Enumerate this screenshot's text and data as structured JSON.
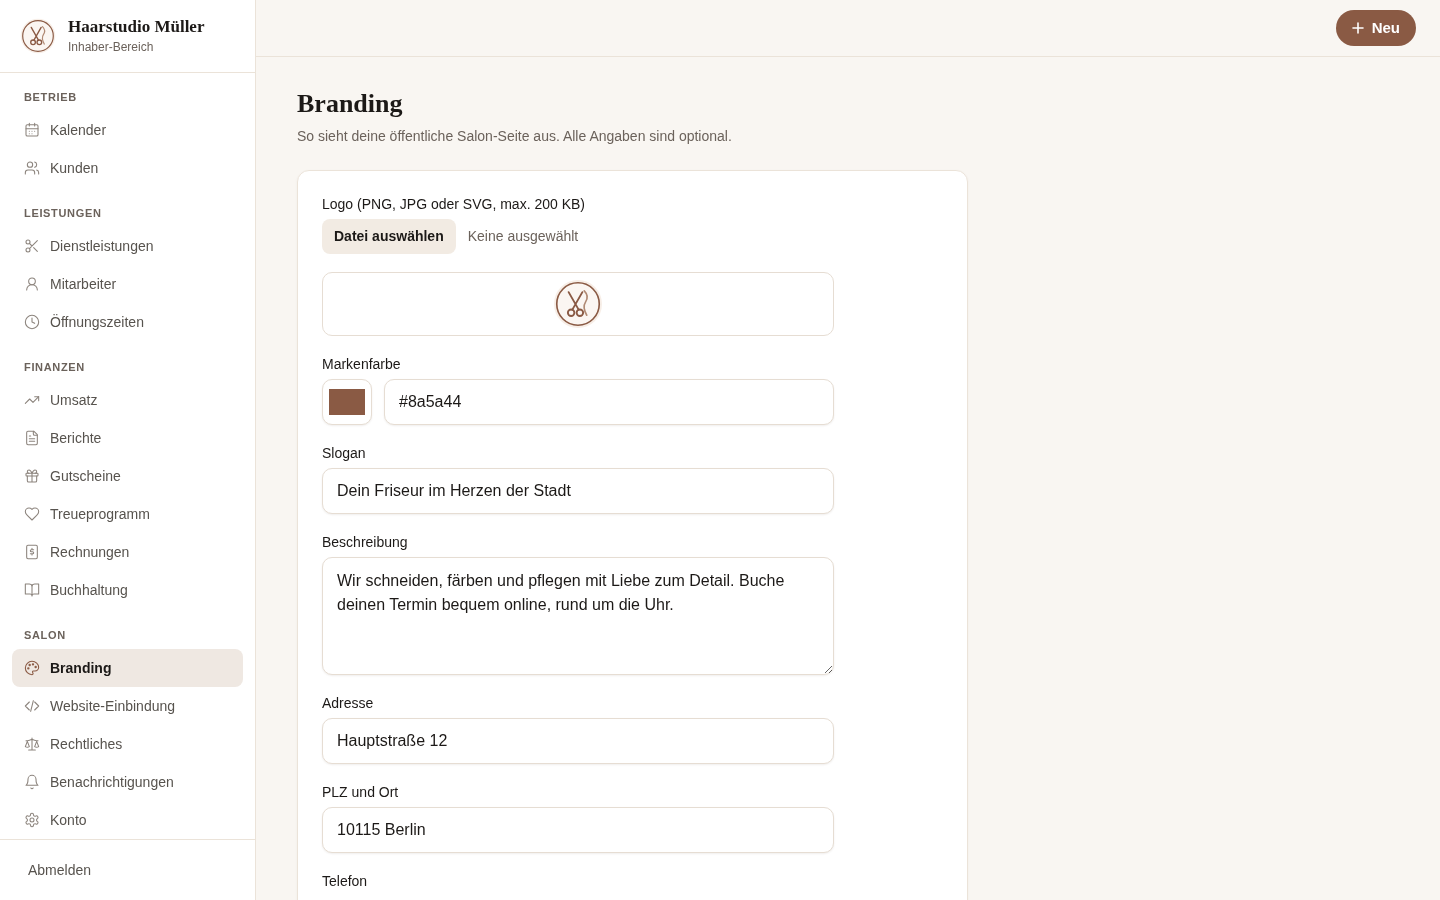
{
  "sidebar": {
    "brand": {
      "name": "Haarstudio Müller",
      "subtitle": "Inhaber-Bereich"
    },
    "sections": [
      {
        "title": "BETRIEB",
        "items": [
          {
            "label": "Kalender",
            "selected": false
          },
          {
            "label": "Kunden",
            "selected": false
          }
        ]
      },
      {
        "title": "LEISTUNGEN",
        "items": [
          {
            "label": "Dienstleistungen",
            "selected": false
          },
          {
            "label": "Mitarbeiter",
            "selected": false
          },
          {
            "label": "Öffnungszeiten",
            "selected": false
          }
        ]
      },
      {
        "title": "FINANZEN",
        "items": [
          {
            "label": "Umsatz",
            "selected": false
          },
          {
            "label": "Berichte",
            "selected": false
          },
          {
            "label": "Gutscheine",
            "selected": false
          },
          {
            "label": "Treueprogramm",
            "selected": false
          },
          {
            "label": "Rechnungen",
            "selected": false
          },
          {
            "label": "Buchhaltung",
            "selected": false
          }
        ]
      },
      {
        "title": "SALON",
        "items": [
          {
            "label": "Branding",
            "selected": true
          },
          {
            "label": "Website-Einbindung",
            "selected": false
          },
          {
            "label": "Rechtliches",
            "selected": false
          },
          {
            "label": "Benachrichtigungen",
            "selected": false
          },
          {
            "label": "Konto",
            "selected": false
          }
        ]
      }
    ],
    "footer": {
      "logout": "Abmelden"
    }
  },
  "topbar": {
    "new_button": "Neu"
  },
  "page": {
    "title": "Branding",
    "subtitle": "So sieht deine öffentliche Salon-Seite aus. Alle Angaben sind optional."
  },
  "form": {
    "fields": [
      {
        "kind": "file",
        "label": "Logo (PNG, JPG oder SVG, max. 200 KB)",
        "button": "Datei auswählen",
        "status": "Keine ausgewählt"
      },
      {
        "kind": "color",
        "label": "Markenfarbe",
        "value": "#8a5a44"
      },
      {
        "kind": "text",
        "label": "Slogan",
        "value": "Dein Friseur im Herzen der Stadt"
      },
      {
        "kind": "textarea",
        "label": "Beschreibung",
        "value": "Wir schneiden, färben und pflegen mit Liebe zum Detail. Buche deinen Termin bequem online, rund um die Uhr."
      },
      {
        "kind": "text",
        "label": "Adresse",
        "value": "Hauptstraße 12"
      },
      {
        "kind": "text",
        "label": "PLZ und Ort",
        "value": "10115 Berlin"
      },
      {
        "kind": "label",
        "label": "Telefon"
      }
    ]
  }
}
